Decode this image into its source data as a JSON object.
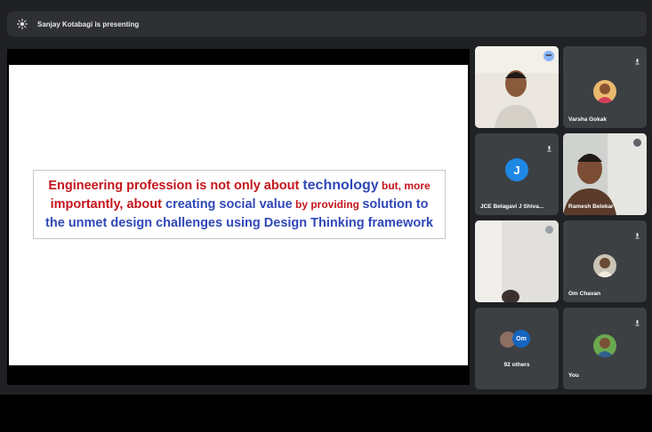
{
  "topbar": {
    "presenter_text": "Sanjay Kotabagi is presenting"
  },
  "slide": {
    "line1": [
      {
        "t": "Engineering profession is not only about ",
        "c": "red"
      },
      {
        "t": "technology",
        "c": "blue big"
      },
      {
        "t": " but, more",
        "c": "red-sm"
      }
    ],
    "line2": [
      {
        "t": "importantly, about ",
        "c": "red"
      },
      {
        "t": "creating social value",
        "c": "blue"
      },
      {
        "t": " by providing ",
        "c": "red-sm"
      },
      {
        "t": "solution to",
        "c": "blue"
      }
    ],
    "line3": [
      {
        "t": "the unmet design challenges using Design Thinking framework",
        "c": "blue"
      }
    ]
  },
  "tiles": [
    {
      "name": "",
      "avatar_letter": "",
      "type": "video-man"
    },
    {
      "name": "Varsha Gokak",
      "avatar_letter": "",
      "type": "avatar-photo"
    },
    {
      "name": "JCE Belagavi J Shiva...",
      "avatar_letter": "J",
      "type": "avatar-letter"
    },
    {
      "name": "Ramesh Belekar",
      "avatar_letter": "",
      "type": "video-man2"
    },
    {
      "name": "",
      "avatar_letter": "",
      "type": "video-room"
    },
    {
      "name": "Om Chavan",
      "avatar_letter": "",
      "type": "avatar-photo2"
    },
    {
      "name": "92 others",
      "avatar_letter": "Om",
      "type": "others"
    },
    {
      "name": "You",
      "avatar_letter": "",
      "type": "avatar-photo3"
    }
  ]
}
